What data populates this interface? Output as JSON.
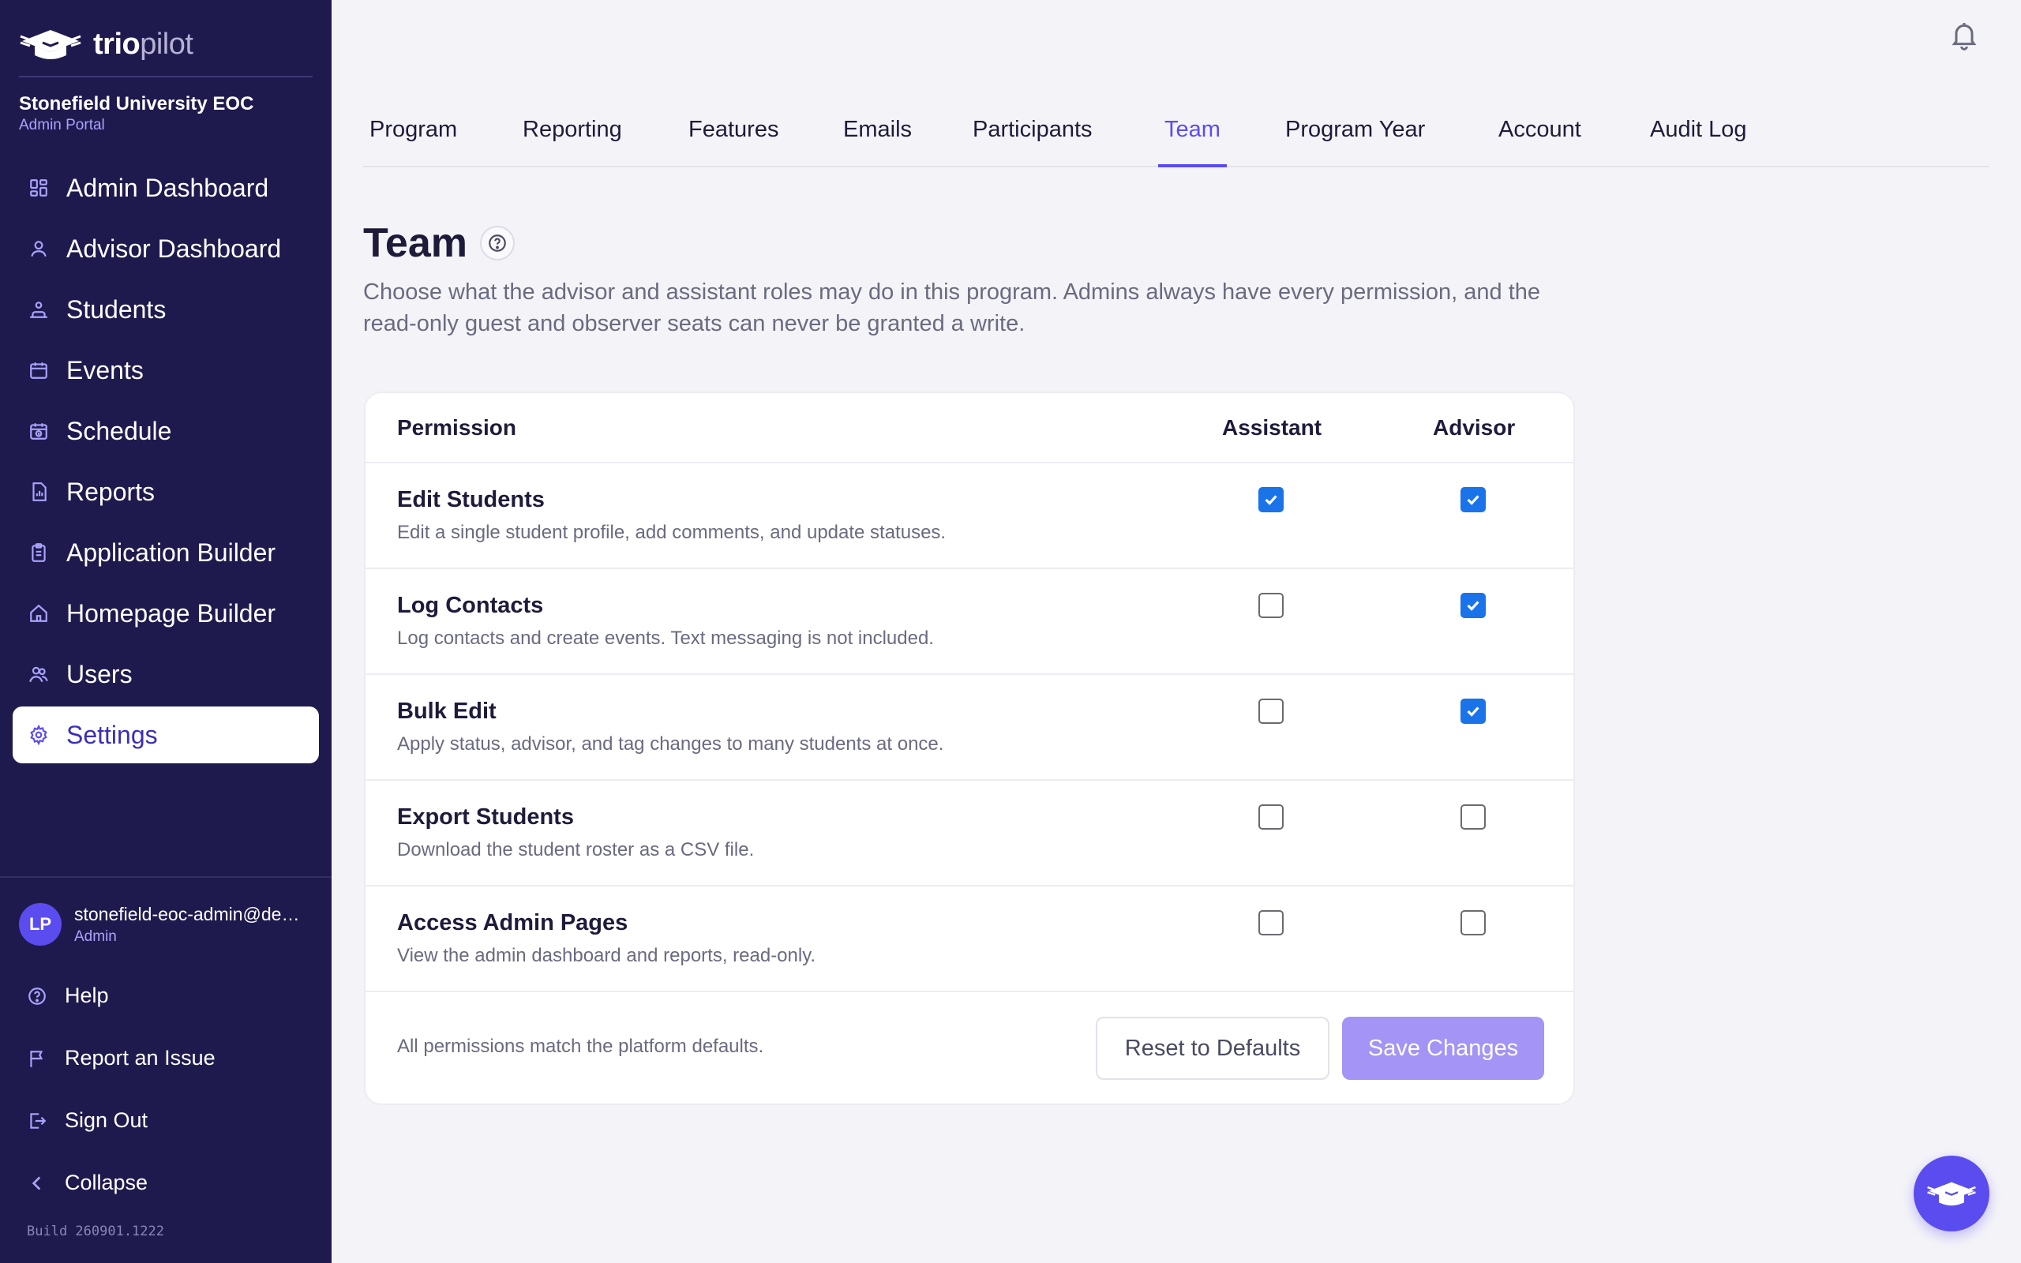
{
  "brand": {
    "name_bold": "trio",
    "name_light": "pilot"
  },
  "org": {
    "name": "Stonefield University EOC",
    "portal": "Admin Portal"
  },
  "sidebar": {
    "items": [
      {
        "label": "Admin Dashboard",
        "icon": "dashboard-icon"
      },
      {
        "label": "Advisor Dashboard",
        "icon": "person-icon"
      },
      {
        "label": "Students",
        "icon": "students-icon"
      },
      {
        "label": "Events",
        "icon": "calendar-icon"
      },
      {
        "label": "Schedule",
        "icon": "schedule-icon"
      },
      {
        "label": "Reports",
        "icon": "report-icon"
      },
      {
        "label": "Application Builder",
        "icon": "clipboard-icon"
      },
      {
        "label": "Homepage Builder",
        "icon": "home-icon"
      },
      {
        "label": "Users",
        "icon": "users-icon"
      },
      {
        "label": "Settings",
        "icon": "gear-icon",
        "active": true
      }
    ]
  },
  "user": {
    "initials": "LP",
    "email": "stonefield-eoc-admin@demo.triopilot.com",
    "role": "Admin"
  },
  "footer": {
    "help": "Help",
    "report_issue": "Report an Issue",
    "sign_out": "Sign Out",
    "collapse": "Collapse"
  },
  "build": "Build 260901.1222",
  "tabs": [
    "Program",
    "Reporting",
    "Features",
    "Emails",
    "Participants",
    "Team",
    "Program Year",
    "Account",
    "Audit Log"
  ],
  "active_tab": "Team",
  "page": {
    "title": "Team",
    "description": "Choose what the advisor and assistant roles may do in this program. Admins always have every permission, and the read-only guest and observer seats can never be granted a write."
  },
  "table": {
    "headers": {
      "permission": "Permission",
      "assistant": "Assistant",
      "advisor": "Advisor"
    },
    "rows": [
      {
        "name": "Edit Students",
        "description": "Edit a single student profile, add comments, and update statuses.",
        "assistant": true,
        "advisor": true
      },
      {
        "name": "Log Contacts",
        "description": "Log contacts and create events. Text messaging is not included.",
        "assistant": false,
        "advisor": true
      },
      {
        "name": "Bulk Edit",
        "description": "Apply status, advisor, and tag changes to many students at once.",
        "assistant": false,
        "advisor": true
      },
      {
        "name": "Export Students",
        "description": "Download the student roster as a CSV file.",
        "assistant": false,
        "advisor": false
      },
      {
        "name": "Access Admin Pages",
        "description": "View the admin dashboard and reports, read-only.",
        "assistant": false,
        "advisor": false
      }
    ]
  },
  "card_footer": {
    "status": "All permissions match the platform defaults.",
    "reset_label": "Reset to Defaults",
    "save_label": "Save Changes"
  },
  "colors": {
    "sidebar_bg": "#1f1a4d",
    "accent": "#5b4cf0",
    "checkbox": "#1a73e8",
    "save_disabled": "#a394f5"
  }
}
